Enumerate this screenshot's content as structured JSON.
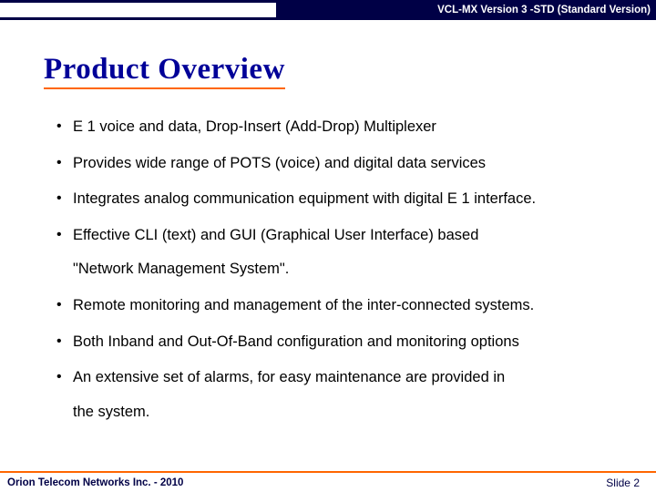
{
  "header": {
    "version": "VCL-MX Version 3 -STD (Standard Version)"
  },
  "title": "Product Overview",
  "bullets": [
    {
      "text": "E 1 voice and data, Drop-Insert (Add-Drop) Multiplexer"
    },
    {
      "text": "Provides wide range of POTS (voice) and digital data services"
    },
    {
      "text": "Integrates analog communication equipment with digital E 1 interface."
    },
    {
      "text": "Effective CLI (text) and GUI (Graphical User Interface) based",
      "cont": "\"Network Management System\"."
    },
    {
      "text": "Remote monitoring and management of the inter-connected systems."
    },
    {
      "text": "Both Inband and Out-Of-Band configuration and monitoring options"
    },
    {
      "text": "An extensive set of alarms, for easy maintenance are provided in",
      "cont": "the system."
    }
  ],
  "footer": {
    "company": "Orion Telecom Networks Inc. - 2010",
    "slide": "Slide 2"
  }
}
